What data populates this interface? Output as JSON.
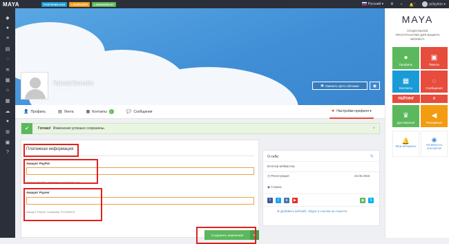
{
  "topbar": {
    "logo": "MAYA",
    "badges": [
      {
        "label": "POSTROBLOGS",
        "color": "#1a9bd7"
      },
      {
        "label": "LINGRUDER",
        "color": "#f39c12"
      },
      {
        "label": "LANDINGBUZZ",
        "color": "#5cb85c"
      }
    ],
    "language": "Русский",
    "notification_count": "9",
    "username": "prilsylern"
  },
  "cover": {
    "name": "Valenij Borodin",
    "date": "profile since 2016",
    "change_cover_label": "Сменить фото обложки"
  },
  "tabs": [
    {
      "label": "Профиль",
      "icon": "person-icon"
    },
    {
      "label": "Лента",
      "icon": "feed-icon"
    },
    {
      "label": "Контакты",
      "icon": "contacts-icon",
      "count": "3"
    },
    {
      "label": "Сообщения",
      "icon": "messages-icon"
    }
  ],
  "settings_tab": "Настройки профиля",
  "alert": {
    "strong": "Готово!",
    "text": "Изменения успешно сохранены."
  },
  "payment": {
    "title": "Платежная информация",
    "paypal_label": "Аккаунт PayPal",
    "paypal_value": "",
    "paypal_help": "Аккаунт PayPal, например user@mail.com",
    "payeer_label": "Аккаунт Payeer",
    "payeer_value": "",
    "payeer_help": "Аккаунт Payeer, например P12345678",
    "save_label": "Сохранить изменения"
  },
  "about": {
    "title": "О себе",
    "bio": "Блоггер вебмастер",
    "registration_label": "Регистрация",
    "registration_date": "22.06.2016",
    "country_label": "Страна",
    "add_links": "Добавить вебсайт, Skype и ссылки на соцсети"
  },
  "right_panel": {
    "logo": "MAYA",
    "subtitle": "СОЦИАЛЬНОЕ ПРОСТРАНСТВО ДЛЯ ВАШЕГО БИЗНЕСА",
    "tiles": [
      {
        "label": "Профиль",
        "color": "#5cb85c"
      },
      {
        "label": "Пакеты",
        "color": "#e74c3c"
      },
      {
        "label": "Контакты",
        "color": "#1a9bd7"
      },
      {
        "label": "Сообщения",
        "color": "#e74c3c"
      }
    ],
    "rating_label": "РЕЙТИНГ",
    "rating_value": "0",
    "tiles2": [
      {
        "label": "Достижения",
        "color": "#5cb85c"
      },
      {
        "label": "Рекламные",
        "color": "#f39c12"
      }
    ],
    "white_tiles": [
      {
        "label": "Мои интересы"
      },
      {
        "label": "Активность контактов"
      }
    ]
  }
}
